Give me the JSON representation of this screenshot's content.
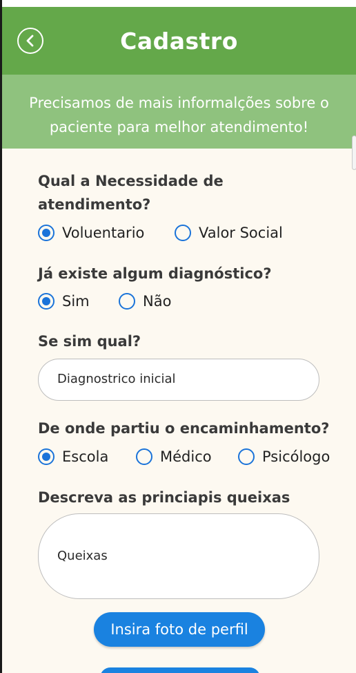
{
  "header": {
    "title": "Cadastro",
    "back_icon": "chevron-left-icon"
  },
  "banner": {
    "text": "Precisamos de mais informalções sobre o paciente para melhor atendimento!"
  },
  "colors": {
    "header_green": "#64a84a",
    "banner_green": "#8fc27e",
    "background": "#fdf9f1",
    "accent_blue": "#1a73d9",
    "button_blue": "#1a82e0"
  },
  "form": {
    "q_need": {
      "label": "Qual a Necessidade de atendimento?",
      "options": [
        "Voluentario",
        "Valor Social"
      ],
      "selected": "Voluentario"
    },
    "q_diagnosis": {
      "label": "Já existe algum diagnóstico?",
      "options": [
        "Sim",
        "Não"
      ],
      "selected": "Sim"
    },
    "q_which": {
      "label": "Se sim qual?",
      "value": "Diagnostrico inicial"
    },
    "q_referral": {
      "label": "De onde partiu o encaminhamento?",
      "options": [
        "Escola",
        "Médico",
        "Psicólogo"
      ],
      "selected": "Escola"
    },
    "q_complaints": {
      "label": "Descreva as princiapis queixas",
      "value": "Queixas"
    }
  },
  "buttons": {
    "photo": "Insira foto de perfil"
  }
}
